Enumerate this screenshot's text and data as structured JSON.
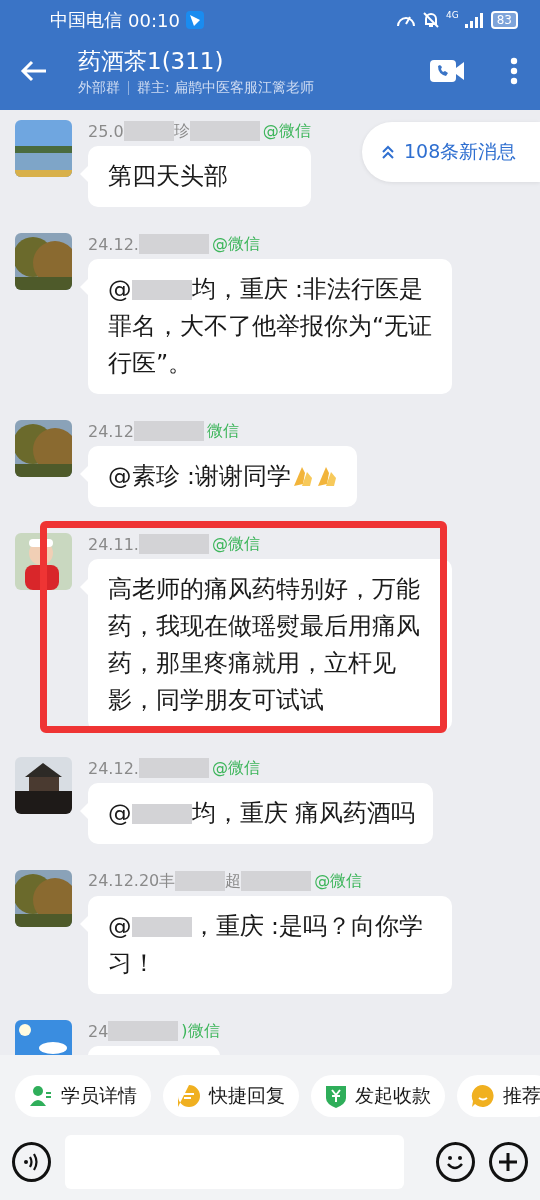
{
  "status_bar": {
    "carrier": "中国电信",
    "time": "00:10",
    "network": "4G",
    "battery": "83"
  },
  "header": {
    "title": "药酒茶1(311)",
    "group_type": "外部群",
    "owner": "群主: 扁鹊中医客服江篱老师"
  },
  "new_messages": {
    "label": "108条新消息"
  },
  "messages": [
    {
      "avatar": {
        "kind": "picture"
      },
      "sender_parts": [
        "25.0",
        "珍"
      ],
      "channel": "@微信",
      "text_parts": [
        "第四天头部"
      ],
      "highlighted": false
    },
    {
      "avatar": {
        "kind": "picture"
      },
      "sender_parts": [
        "24.12."
      ],
      "channel": "@微信",
      "text_parts": [
        "@",
        "均，重庆 :非法行医是罪名，大不了他举报你为“无证行医”。"
      ],
      "highlighted": false
    },
    {
      "avatar": {
        "kind": "picture"
      },
      "sender_parts": [
        "24.12"
      ],
      "channel": "微信",
      "text_parts": [
        "@素珍 :谢谢同学"
      ],
      "stickers": [
        {
          "kind": "hands"
        },
        {
          "kind": "hands"
        }
      ],
      "highlighted": false
    },
    {
      "avatar": {
        "kind": "picture"
      },
      "sender_parts": [
        "24.11."
      ],
      "channel": "@微信",
      "text_parts": [
        "高老师的痛风药特别好，万能药，我现在做瑶熨最后用痛风药，那里疼痛就用，立杆见影，同学朋友可试试"
      ],
      "highlighted": true
    },
    {
      "avatar": {
        "kind": "picture"
      },
      "sender_parts": [
        "24.12."
      ],
      "channel": "@微信",
      "text_parts": [
        "@",
        "均，重庆 痛风药酒吗"
      ],
      "highlighted": false
    },
    {
      "avatar": {
        "kind": "picture"
      },
      "sender_parts": [
        "24.12.20丰",
        "超"
      ],
      "channel": "@微信",
      "text_parts": [
        "@",
        "，重庆 :是吗？向你学习！"
      ],
      "highlighted": false
    },
    {
      "avatar": {
        "kind": "picture"
      },
      "sender_parts": [
        "24"
      ],
      "channel": ")微信",
      "highlighted": false
    }
  ],
  "quick_actions": [
    {
      "label": "学员详情",
      "kind": "student"
    },
    {
      "label": "快捷回复",
      "kind": "reply"
    },
    {
      "label": "发起收款",
      "kind": "payment"
    },
    {
      "label": "推荐",
      "kind": "recommend"
    }
  ]
}
